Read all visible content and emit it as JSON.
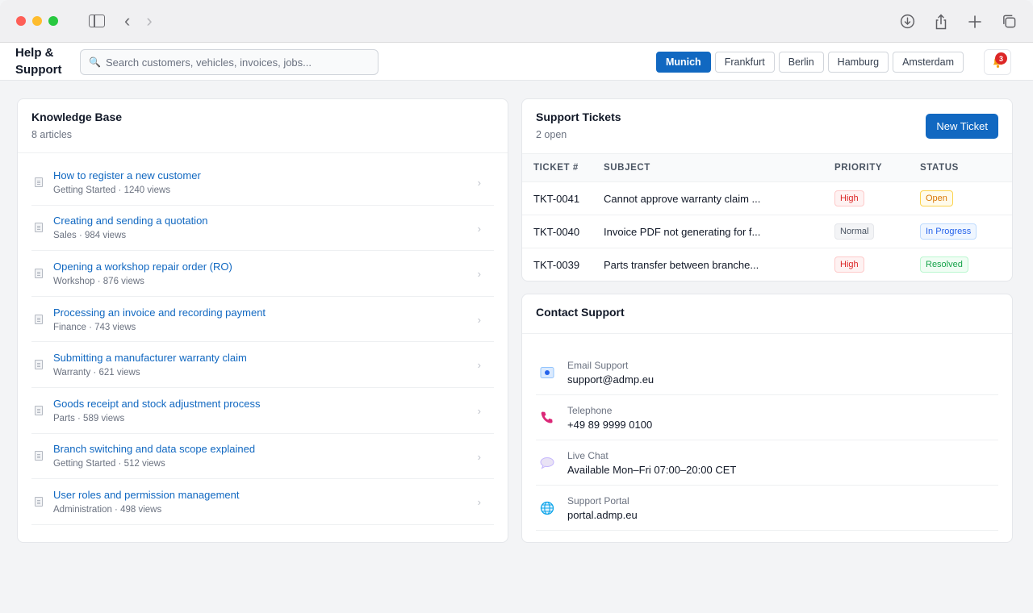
{
  "app": {
    "title": "Help & Support"
  },
  "search": {
    "placeholder": "Search customers, vehicles, invoices, jobs..."
  },
  "branches": [
    "Munich",
    "Frankfurt",
    "Berlin",
    "Hamburg",
    "Amsterdam"
  ],
  "active_branch": "Munich",
  "notifications": {
    "count": "3"
  },
  "knowledge_base": {
    "title": "Knowledge Base",
    "subtitle": "8 articles",
    "articles": [
      {
        "title": "How to register a new customer",
        "meta": "Getting Started · 1240 views"
      },
      {
        "title": "Creating and sending a quotation",
        "meta": "Sales · 984 views"
      },
      {
        "title": "Opening a workshop repair order (RO)",
        "meta": "Workshop · 876 views"
      },
      {
        "title": "Processing an invoice and recording payment",
        "meta": "Finance · 743 views"
      },
      {
        "title": "Submitting a manufacturer warranty claim",
        "meta": "Warranty · 621 views"
      },
      {
        "title": "Goods receipt and stock adjustment process",
        "meta": "Parts · 589 views"
      },
      {
        "title": "Branch switching and data scope explained",
        "meta": "Getting Started · 512 views"
      },
      {
        "title": "User roles and permission management",
        "meta": "Administration · 498 views"
      }
    ]
  },
  "tickets": {
    "title": "Support Tickets",
    "subtitle": "2 open",
    "new_button": "New Ticket",
    "columns": [
      "TICKET #",
      "SUBJECT",
      "PRIORITY",
      "STATUS"
    ],
    "rows": [
      {
        "id": "TKT-0041",
        "subject": "Cannot approve warranty claim ...",
        "priority": "High",
        "status": "Open"
      },
      {
        "id": "TKT-0040",
        "subject": "Invoice PDF not generating for f...",
        "priority": "Normal",
        "status": "In Progress"
      },
      {
        "id": "TKT-0039",
        "subject": "Parts transfer between branche...",
        "priority": "High",
        "status": "Resolved"
      }
    ]
  },
  "contact": {
    "title": "Contact Support",
    "items": [
      {
        "label": "Email Support",
        "value": "support@admp.eu",
        "icon": "email-icon"
      },
      {
        "label": "Telephone",
        "value": "+49 89 9999 0100",
        "icon": "phone-icon"
      },
      {
        "label": "Live Chat",
        "value": "Available Mon–Fri 07:00–20:00 CET",
        "icon": "chat-icon"
      },
      {
        "label": "Support Portal",
        "value": "portal.admp.eu",
        "icon": "globe-icon"
      }
    ]
  },
  "colors": {
    "accent": "#1168c1",
    "high": "#dc2626",
    "open": "#d97706",
    "in_progress": "#2563eb",
    "resolved": "#16a34a"
  }
}
